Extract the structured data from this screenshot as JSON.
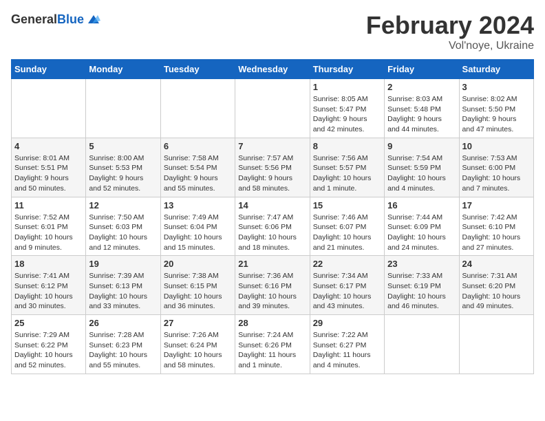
{
  "header": {
    "logo_general": "General",
    "logo_blue": "Blue",
    "title": "February 2024",
    "subtitle": "Vol'noye, Ukraine"
  },
  "calendar": {
    "days_of_week": [
      "Sunday",
      "Monday",
      "Tuesday",
      "Wednesday",
      "Thursday",
      "Friday",
      "Saturday"
    ],
    "weeks": [
      [
        {
          "day": "",
          "info": ""
        },
        {
          "day": "",
          "info": ""
        },
        {
          "day": "",
          "info": ""
        },
        {
          "day": "",
          "info": ""
        },
        {
          "day": "1",
          "info": "Sunrise: 8:05 AM\nSunset: 5:47 PM\nDaylight: 9 hours\nand 42 minutes."
        },
        {
          "day": "2",
          "info": "Sunrise: 8:03 AM\nSunset: 5:48 PM\nDaylight: 9 hours\nand 44 minutes."
        },
        {
          "day": "3",
          "info": "Sunrise: 8:02 AM\nSunset: 5:50 PM\nDaylight: 9 hours\nand 47 minutes."
        }
      ],
      [
        {
          "day": "4",
          "info": "Sunrise: 8:01 AM\nSunset: 5:51 PM\nDaylight: 9 hours\nand 50 minutes."
        },
        {
          "day": "5",
          "info": "Sunrise: 8:00 AM\nSunset: 5:53 PM\nDaylight: 9 hours\nand 52 minutes."
        },
        {
          "day": "6",
          "info": "Sunrise: 7:58 AM\nSunset: 5:54 PM\nDaylight: 9 hours\nand 55 minutes."
        },
        {
          "day": "7",
          "info": "Sunrise: 7:57 AM\nSunset: 5:56 PM\nDaylight: 9 hours\nand 58 minutes."
        },
        {
          "day": "8",
          "info": "Sunrise: 7:56 AM\nSunset: 5:57 PM\nDaylight: 10 hours\nand 1 minute."
        },
        {
          "day": "9",
          "info": "Sunrise: 7:54 AM\nSunset: 5:59 PM\nDaylight: 10 hours\nand 4 minutes."
        },
        {
          "day": "10",
          "info": "Sunrise: 7:53 AM\nSunset: 6:00 PM\nDaylight: 10 hours\nand 7 minutes."
        }
      ],
      [
        {
          "day": "11",
          "info": "Sunrise: 7:52 AM\nSunset: 6:01 PM\nDaylight: 10 hours\nand 9 minutes."
        },
        {
          "day": "12",
          "info": "Sunrise: 7:50 AM\nSunset: 6:03 PM\nDaylight: 10 hours\nand 12 minutes."
        },
        {
          "day": "13",
          "info": "Sunrise: 7:49 AM\nSunset: 6:04 PM\nDaylight: 10 hours\nand 15 minutes."
        },
        {
          "day": "14",
          "info": "Sunrise: 7:47 AM\nSunset: 6:06 PM\nDaylight: 10 hours\nand 18 minutes."
        },
        {
          "day": "15",
          "info": "Sunrise: 7:46 AM\nSunset: 6:07 PM\nDaylight: 10 hours\nand 21 minutes."
        },
        {
          "day": "16",
          "info": "Sunrise: 7:44 AM\nSunset: 6:09 PM\nDaylight: 10 hours\nand 24 minutes."
        },
        {
          "day": "17",
          "info": "Sunrise: 7:42 AM\nSunset: 6:10 PM\nDaylight: 10 hours\nand 27 minutes."
        }
      ],
      [
        {
          "day": "18",
          "info": "Sunrise: 7:41 AM\nSunset: 6:12 PM\nDaylight: 10 hours\nand 30 minutes."
        },
        {
          "day": "19",
          "info": "Sunrise: 7:39 AM\nSunset: 6:13 PM\nDaylight: 10 hours\nand 33 minutes."
        },
        {
          "day": "20",
          "info": "Sunrise: 7:38 AM\nSunset: 6:15 PM\nDaylight: 10 hours\nand 36 minutes."
        },
        {
          "day": "21",
          "info": "Sunrise: 7:36 AM\nSunset: 6:16 PM\nDaylight: 10 hours\nand 39 minutes."
        },
        {
          "day": "22",
          "info": "Sunrise: 7:34 AM\nSunset: 6:17 PM\nDaylight: 10 hours\nand 43 minutes."
        },
        {
          "day": "23",
          "info": "Sunrise: 7:33 AM\nSunset: 6:19 PM\nDaylight: 10 hours\nand 46 minutes."
        },
        {
          "day": "24",
          "info": "Sunrise: 7:31 AM\nSunset: 6:20 PM\nDaylight: 10 hours\nand 49 minutes."
        }
      ],
      [
        {
          "day": "25",
          "info": "Sunrise: 7:29 AM\nSunset: 6:22 PM\nDaylight: 10 hours\nand 52 minutes."
        },
        {
          "day": "26",
          "info": "Sunrise: 7:28 AM\nSunset: 6:23 PM\nDaylight: 10 hours\nand 55 minutes."
        },
        {
          "day": "27",
          "info": "Sunrise: 7:26 AM\nSunset: 6:24 PM\nDaylight: 10 hours\nand 58 minutes."
        },
        {
          "day": "28",
          "info": "Sunrise: 7:24 AM\nSunset: 6:26 PM\nDaylight: 11 hours\nand 1 minute."
        },
        {
          "day": "29",
          "info": "Sunrise: 7:22 AM\nSunset: 6:27 PM\nDaylight: 11 hours\nand 4 minutes."
        },
        {
          "day": "",
          "info": ""
        },
        {
          "day": "",
          "info": ""
        }
      ]
    ]
  }
}
